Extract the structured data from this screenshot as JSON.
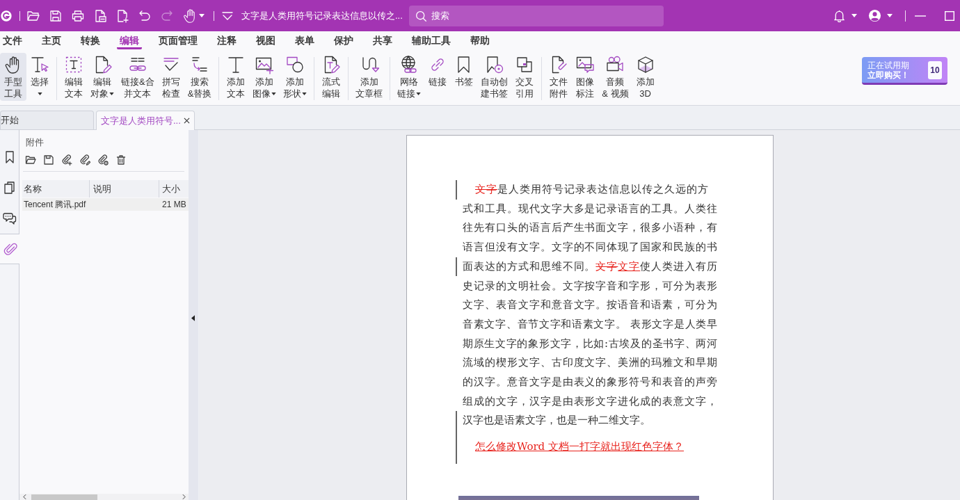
{
  "title_bar": {
    "quick_access": [
      {
        "disabled": false,
        "dropdown": false
      },
      {
        "disabled": false,
        "dropdown": false
      },
      {
        "disabled": false,
        "dropdown": false
      },
      {
        "disabled": false,
        "dropdown": false
      },
      {
        "disabled": false,
        "dropdown": false
      },
      {
        "disabled": false,
        "dropdown": false
      },
      {
        "disabled": true,
        "dropdown": false
      },
      {
        "disabled": false,
        "dropdown": true
      }
    ],
    "document_title": "文字是人类用符号记录表达信息以传之...",
    "search": {
      "placeholder": "搜索"
    }
  },
  "menu_tabs": [
    {
      "label": "文件",
      "selected": false
    },
    {
      "label": "主页",
      "selected": false
    },
    {
      "label": "转换",
      "selected": false
    },
    {
      "label": "编辑",
      "selected": true
    },
    {
      "label": "页面管理",
      "selected": false
    },
    {
      "label": "注释",
      "selected": false
    },
    {
      "label": "视图",
      "selected": false
    },
    {
      "label": "表单",
      "selected": false
    },
    {
      "label": "保护",
      "selected": false
    },
    {
      "label": "共享",
      "selected": false
    },
    {
      "label": "辅助工具",
      "selected": false
    },
    {
      "label": "帮助",
      "selected": false
    }
  ],
  "ribbon": {
    "groups": [
      {
        "tools": [
          {
            "lines": [
              "手型",
              "工具"
            ],
            "dropdown": false,
            "selected": true
          },
          {
            "lines": [
              "选择"
            ],
            "dropdown": true,
            "selected": false
          }
        ]
      },
      {
        "tools": [
          {
            "lines": [
              "编辑",
              "文本"
            ],
            "dropdown": false,
            "selected": false
          },
          {
            "lines": [
              "编辑",
              "对象"
            ],
            "dropdown": true,
            "selected": false
          },
          {
            "lines": [
              "链接&合",
              "并文本"
            ],
            "dropdown": false,
            "selected": false
          },
          {
            "lines": [
              "拼写",
              "检查"
            ],
            "dropdown": false,
            "selected": false
          },
          {
            "lines": [
              "搜索",
              "&替换"
            ],
            "dropdown": false,
            "selected": false
          }
        ]
      },
      {
        "tools": [
          {
            "lines": [
              "添加",
              "文本"
            ],
            "dropdown": false,
            "selected": false
          },
          {
            "lines": [
              "添加",
              "图像"
            ],
            "dropdown": true,
            "selected": false
          },
          {
            "lines": [
              "添加",
              "形状"
            ],
            "dropdown": true,
            "selected": false
          }
        ]
      },
      {
        "tools": [
          {
            "lines": [
              "流式",
              "编辑"
            ],
            "dropdown": false,
            "selected": false
          }
        ]
      },
      {
        "tools": [
          {
            "lines": [
              "添加",
              "文章框"
            ],
            "dropdown": false,
            "selected": false
          }
        ]
      },
      {
        "tools": [
          {
            "lines": [
              "网络",
              "链接"
            ],
            "dropdown": true,
            "selected": false
          },
          {
            "lines": [
              "链接"
            ],
            "dropdown": false,
            "selected": false
          },
          {
            "lines": [
              "书签"
            ],
            "dropdown": false,
            "selected": false
          },
          {
            "lines": [
              "自动创",
              "建书签"
            ],
            "dropdown": false,
            "selected": false
          },
          {
            "lines": [
              "交叉",
              "引用"
            ],
            "dropdown": false,
            "selected": false
          }
        ]
      },
      {
        "tools": [
          {
            "lines": [
              "文件",
              "附件"
            ],
            "dropdown": false,
            "selected": false
          },
          {
            "lines": [
              "图像",
              "标注"
            ],
            "dropdown": false,
            "selected": false
          },
          {
            "lines": [
              "音频",
              "& 视频"
            ],
            "dropdown": false,
            "selected": false
          },
          {
            "lines": [
              "添加",
              "3D"
            ],
            "dropdown": false,
            "selected": false
          }
        ]
      }
    ],
    "trial_button": {
      "lines": [
        "正在试用期",
        "立即购买！"
      ],
      "badge": "10"
    }
  },
  "document_tabs": [
    {
      "label": "开始",
      "selected": false,
      "closable": false
    },
    {
      "label": "文字是人类用符号...",
      "selected": true,
      "closable": true
    }
  ],
  "side_nav": [
    {
      "selected": false
    },
    {
      "selected": false
    },
    {
      "selected": false
    },
    {
      "selected": true
    }
  ],
  "attachments_panel": {
    "title": "附件",
    "columns": [
      "名称",
      "说明",
      "大小"
    ],
    "rows": [
      {
        "name": "Tencent 腾讯.pdf",
        "size": "21 MB",
        "selected": true
      }
    ]
  },
  "document": {
    "lines": [
      {
        "changed": true,
        "segments": [
          {
            "kind": "deleted",
            "text": "文字"
          },
          {
            "kind": "normal",
            "text": "是人类用符号记录表达信息以传之久远的方"
          }
        ]
      },
      {
        "changed": false,
        "segments": [
          {
            "kind": "normal",
            "text": "式和工具。现代文字大多是记录语言的工具。人类往"
          }
        ]
      },
      {
        "changed": false,
        "segments": [
          {
            "kind": "normal",
            "text": "往先有口头的语言后产生书面文字，很多小语种，有"
          }
        ]
      },
      {
        "changed": false,
        "segments": [
          {
            "kind": "normal",
            "text": "语言但没有文字。文字的不同体现了国家和民族的书"
          }
        ]
      },
      {
        "changed": true,
        "segments": [
          {
            "kind": "normal",
            "text": "面表达的方式和思维不同。"
          },
          {
            "kind": "deleted",
            "text": "文字"
          },
          {
            "kind": "inserted",
            "text": "文字"
          },
          {
            "kind": "normal",
            "text": "使人类进入有历"
          }
        ]
      },
      {
        "changed": false,
        "segments": [
          {
            "kind": "normal",
            "text": "史记录的文明社会。文字按字音和字形，可分为表形"
          }
        ]
      },
      {
        "changed": false,
        "segments": [
          {
            "kind": "normal",
            "text": "文字、表音文字和意音文字。按语音和语素，可分为"
          }
        ]
      },
      {
        "changed": false,
        "segments": [
          {
            "kind": "normal",
            "text": "音素文字、音节文字和语素文字。 表形文字是人类早"
          }
        ]
      },
      {
        "changed": false,
        "segments": [
          {
            "kind": "normal",
            "text": "期原生文字的象形文字，比如:古埃及的圣书字、两河"
          }
        ]
      },
      {
        "changed": false,
        "segments": [
          {
            "kind": "normal",
            "text": "流域的楔形文字、古印度文字、美洲的玛雅文和早期"
          }
        ]
      },
      {
        "changed": false,
        "segments": [
          {
            "kind": "normal",
            "text": "的汉字。意音文字是由表义的象形符号和表音的声旁"
          }
        ]
      },
      {
        "changed": false,
        "segments": [
          {
            "kind": "normal",
            "text": "组成的文字，汉字是由表形文字进化成的表意文字，"
          }
        ]
      },
      {
        "changed": true,
        "segments": [
          {
            "kind": "normal",
            "text": "汉字也是语素文字，也是一种二维文字。"
          }
        ]
      }
    ],
    "link": {
      "text": "怎么修改Word 文档一打字就出现红色字体？",
      "changed": true
    }
  }
}
